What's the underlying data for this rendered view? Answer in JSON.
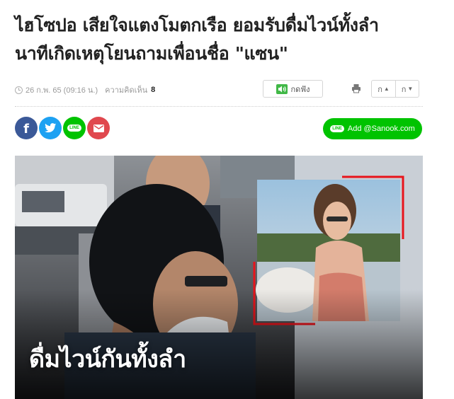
{
  "article": {
    "title_line1": "ไฮโซปอ เสียใจแตงโมตกเรือ ยอมรับดื่มไวน์ทั้งลำ",
    "title_line2": "นาทีเกิดเหตุโยนถามเพื่อนชื่อ \"แซน\""
  },
  "meta": {
    "timestamp": "26 ก.พ. 65 (09:16 น.)",
    "comments_label": "ความคิดเห็น",
    "comments_count": "8",
    "listen_label": "กดฟัง",
    "font_increase": "ก",
    "font_decrease": "ก"
  },
  "share": {
    "facebook_glyph": "f",
    "line_glyph": "LINE",
    "add_line_label": "Add @Sanook.com"
  },
  "hero": {
    "caption": "ดื่มไวน์กันทั้งลำ"
  },
  "colors": {
    "facebook": "#3b5998",
    "twitter": "#1da1f2",
    "line": "#00c300",
    "mail": "#e0484e",
    "frame_red": "#e8141b"
  },
  "icons": [
    "clock-icon",
    "speaker-icon",
    "print-icon",
    "facebook-icon",
    "twitter-icon",
    "line-icon",
    "mail-icon"
  ]
}
